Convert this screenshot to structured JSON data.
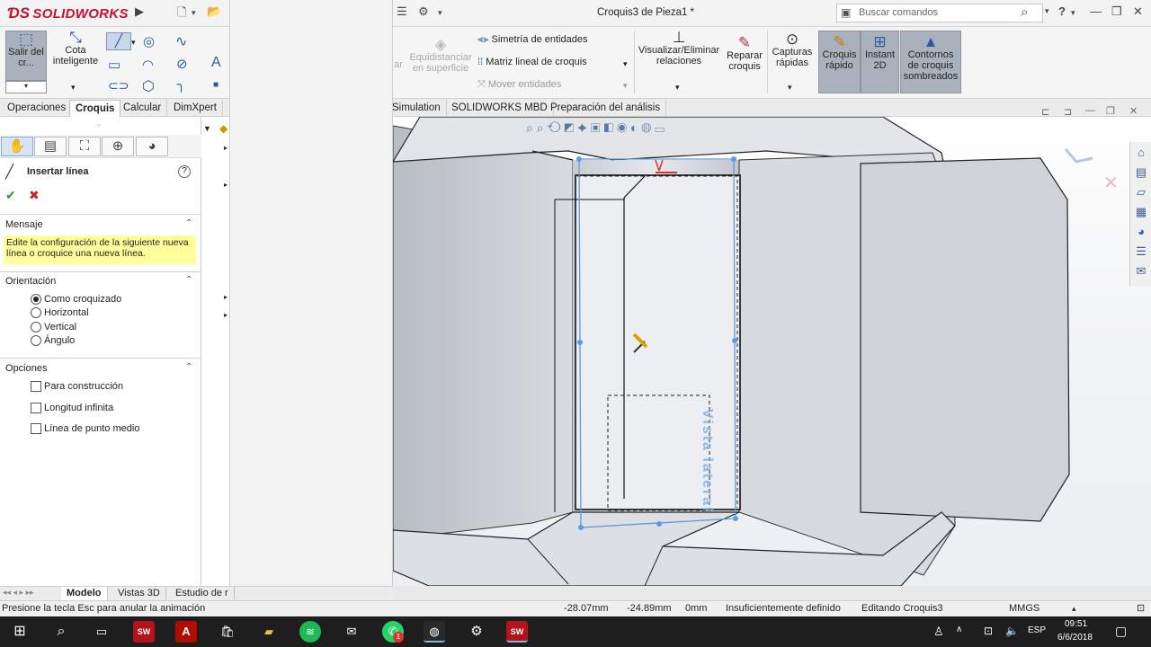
{
  "titlebar": {
    "app_name": "SOLIDWORKS",
    "document_title": "Croquis3 de Pieza1 *",
    "search_placeholder": "Buscar comandos",
    "help_label": "?"
  },
  "ribbon": {
    "exit_sketch": "Salir del cr...",
    "smart_dimension": "Cota inteligente",
    "offset_partial": "ar",
    "offset_surface": "Equidistanciar en superficie",
    "mirror_entities": "Simetría de entidades",
    "linear_pattern": "Matriz lineal de croquis",
    "move_entities": "Mover entidades",
    "display_relations": "Visualizar/Eliminar relaciones",
    "repair_sketch": "Reparar croquis",
    "quick_snaps": "Capturas rápidas",
    "rapid_sketch": "Croquis rápido",
    "instant2d": "Instant 2D",
    "shaded_contours": "Contornos de croquis sombreados"
  },
  "tabs": [
    {
      "label": "Operaciones"
    },
    {
      "label": "Croquis",
      "selected": true
    },
    {
      "label": "Calcular"
    },
    {
      "label": "DimXpert"
    },
    {
      "label": "Simulation"
    },
    {
      "label": "SOLIDWORKS MBD"
    },
    {
      "label": "Preparación del análisis"
    }
  ],
  "property_manager": {
    "title": "Insertar línea",
    "help": "?",
    "message_header": "Mensaje",
    "message_text": "Edite la configuración de la siguiente nueva línea o croquice una nueva línea.",
    "orientation_header": "Orientación",
    "orientation_options": [
      "Como croquizado",
      "Horizontal",
      "Vertical",
      "Ángulo"
    ],
    "orientation_selected": "Como croquizado",
    "options_header": "Opciones",
    "options": [
      "Para construcción",
      "Longitud infinita",
      "Línea de punto medio"
    ]
  },
  "viewport": {
    "view_label": "Vista lateral"
  },
  "bottom_tabs": [
    {
      "label": "Modelo",
      "selected": true
    },
    {
      "label": "Vistas 3D"
    },
    {
      "label": "Estudio de r"
    }
  ],
  "status": {
    "hint": "Presione la tecla Esc para anular la animación",
    "x": "-28.07mm",
    "y": "-24.89mm",
    "z": "0mm",
    "definition": "Insuficientemente definido",
    "editing": "Editando Croquis3",
    "units": "MMGS"
  },
  "taskbar": {
    "language": "ESP",
    "time": "09:51",
    "date": "6/6/2018",
    "badge_count": "1"
  },
  "colors": {
    "brand_red": "#c8102e",
    "sketch_blue": "#4a90d9",
    "message_yellow": "#ffff9c",
    "taskbar_bg": "#1e1e1e"
  }
}
